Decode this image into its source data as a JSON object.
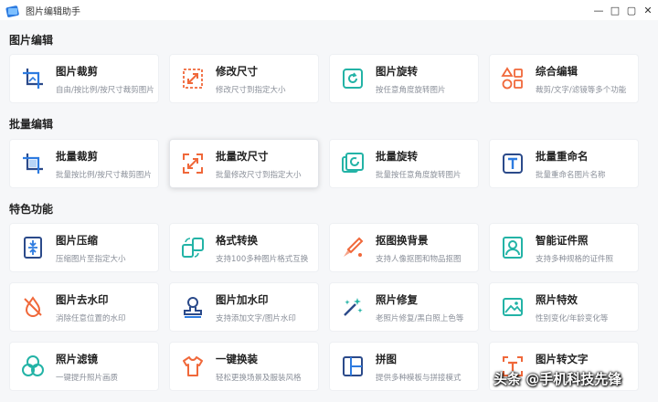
{
  "window": {
    "title": "图片编辑助手",
    "minimize": "—",
    "restore": "□",
    "maximize": "▢",
    "close": "✕"
  },
  "sections": {
    "edit": {
      "title": "图片编辑",
      "items": [
        {
          "name": "图片裁剪",
          "desc": "自由/按比例/按尺寸裁剪图片",
          "icon": "crop-icon"
        },
        {
          "name": "修改尺寸",
          "desc": "修改尺寸到指定大小",
          "icon": "resize-icon"
        },
        {
          "name": "图片旋转",
          "desc": "按任意角度旋转图片",
          "icon": "rotate-icon"
        },
        {
          "name": "综合编辑",
          "desc": "裁剪/文字/滤镜等多个功能",
          "icon": "shapes-icon"
        }
      ]
    },
    "batch": {
      "title": "批量编辑",
      "items": [
        {
          "name": "批量裁剪",
          "desc": "批量按比例/按尺寸裁剪图片",
          "icon": "batch-crop-icon"
        },
        {
          "name": "批量改尺寸",
          "desc": "批量修改尺寸到指定大小",
          "icon": "batch-resize-icon"
        },
        {
          "name": "批量旋转",
          "desc": "批量按任意角度旋转图片",
          "icon": "batch-rotate-icon"
        },
        {
          "name": "批量重命名",
          "desc": "批量重命名图片名称",
          "icon": "rename-icon"
        }
      ]
    },
    "special": {
      "title": "特色功能",
      "items": [
        {
          "name": "图片压缩",
          "desc": "压缩图片至指定大小",
          "icon": "compress-icon"
        },
        {
          "name": "格式转换",
          "desc": "支持100多种图片格式互换",
          "icon": "convert-icon"
        },
        {
          "name": "抠图换背景",
          "desc": "支持人像抠图和物品抠图",
          "icon": "cutout-icon"
        },
        {
          "name": "智能证件照",
          "desc": "支持多种规格的证件照",
          "icon": "id-photo-icon"
        },
        {
          "name": "图片去水印",
          "desc": "消除任意位置的水印",
          "icon": "remove-watermark-icon"
        },
        {
          "name": "图片加水印",
          "desc": "支持添加文字/图片水印",
          "icon": "stamp-icon"
        },
        {
          "name": "照片修复",
          "desc": "老照片修复/黑白照上色等",
          "icon": "magic-wand-icon"
        },
        {
          "name": "照片特效",
          "desc": "性别变化/年龄变化等",
          "icon": "effects-icon"
        },
        {
          "name": "照片滤镜",
          "desc": "一键提升照片画质",
          "icon": "filter-icon"
        },
        {
          "name": "一键换装",
          "desc": "轻松更换场景及服装风格",
          "icon": "tshirt-icon"
        },
        {
          "name": "拼图",
          "desc": "提供多种模板与拼接模式",
          "icon": "collage-icon"
        },
        {
          "name": "图片转文字",
          "desc": "",
          "icon": "ocr-icon"
        }
      ]
    }
  },
  "watermark": "头条 @手机科技先锋",
  "colors": {
    "blue": "#2d7be0",
    "orange": "#f0683a",
    "teal": "#23b3a6",
    "navy": "#2b4a8a"
  }
}
